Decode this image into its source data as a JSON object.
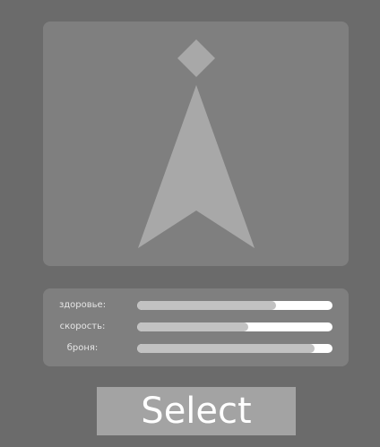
{
  "colors": {
    "background": "#6b6b6b",
    "panel": "#7f7f7f",
    "ship": "#a8a8a8",
    "bar_track": "#ffffff",
    "bar_fill": "#c2c2c2",
    "button": "#a3a3a3",
    "button_text": "#ffffff",
    "label_text": "#e6e6e6"
  },
  "preview": {
    "icon": "ship-arrow-icon",
    "marker_icon": "diamond-icon"
  },
  "stats": [
    {
      "label": "здоровье:",
      "value": 0.71
    },
    {
      "label": "скорость:",
      "value": 0.57
    },
    {
      "label": "броня:",
      "value": 0.91
    }
  ],
  "select_button": {
    "label": "Select"
  }
}
